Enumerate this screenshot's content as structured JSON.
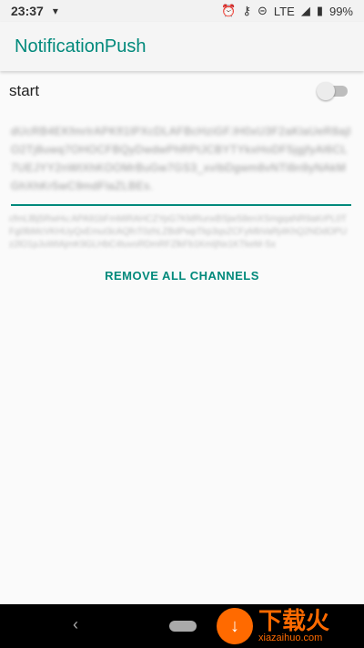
{
  "status_bar": {
    "time": "23:37",
    "lte": "LTE",
    "battery": "99%"
  },
  "app": {
    "title": "NotificationPush"
  },
  "switch": {
    "label": "start",
    "checked": false
  },
  "token_field": {
    "value": "dUcRB4EKfmrlrAPKfl1lPXcDLAFBcHziGF.lH0xU3F2aKlaUeR8ajlO2Tj8uwq7OHOCFBQyDwdwPhRPtJCBYTYkxHoDF5jgjfyAl6CL7UEJYY2nWtXhKOOMrBuGw7GS3_xvIbDgwm8vNTl8n9yNAkMGhXhKr5wC9mdFlaZLBEs."
  },
  "info": {
    "text": "cfmLlBj5RwHu:APA91bFmMiRAHCZYpG7KMRunxBSjwS8enXSmgqaNR9aKrPL0TFg0lbMcVKHUyQxEmuI3cAQfnT0zhLZBdPwpTkp3qsZCFyMbVaRj4KhQ2NDdOPUz2lO1pJuWtAjmK9GLHbC4tuvoRDmRFZlkFb1KmIjNx1KTkeM-Sx"
  },
  "actions": {
    "remove_all": "REMOVE ALL CHANNELS"
  },
  "watermark": {
    "main": "下载火",
    "sub": "xiazaihuo.com"
  },
  "colors": {
    "accent": "#00897b",
    "watermark": "#ff6a00"
  }
}
